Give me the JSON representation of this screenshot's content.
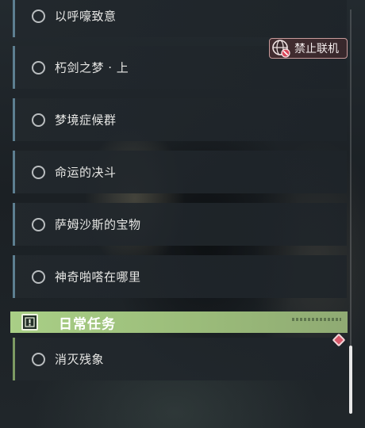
{
  "quests": [
    {
      "label": "以呼嚎致意"
    },
    {
      "label": "朽剑之梦 · 上"
    },
    {
      "label": "梦境症候群"
    },
    {
      "label": "命运的决斗"
    },
    {
      "label": "萨姆沙斯的宝物"
    },
    {
      "label": "神奇啪嗒在哪里"
    }
  ],
  "badge": {
    "label": "禁止联机",
    "icon": "no-multiplayer-icon"
  },
  "daily_section": {
    "title": "日常任务",
    "icon": "exclamation-icon",
    "items": [
      {
        "label": "消灭残象"
      }
    ]
  },
  "marker_icon": "diamond-marker-icon",
  "colors": {
    "accent_green": "#a9cf86",
    "badge_border": "#c79a9a",
    "marker_red": "#d8586a"
  }
}
